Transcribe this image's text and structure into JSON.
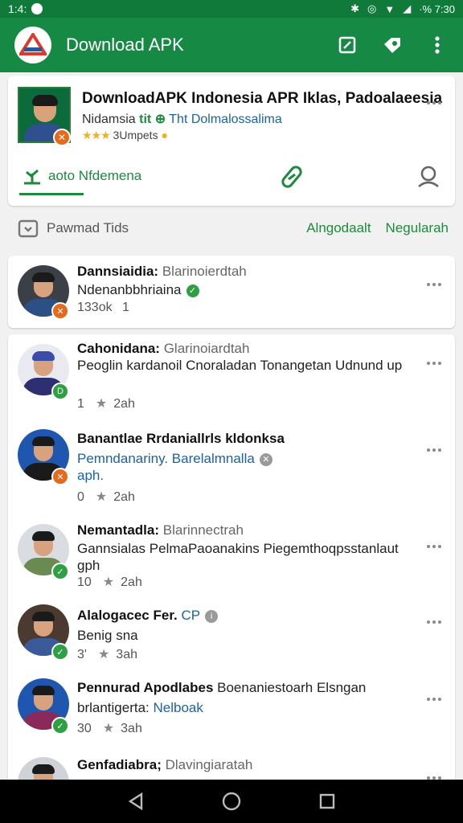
{
  "status": {
    "time": "1:4:",
    "right": "·% 7:30"
  },
  "appbar": {
    "title": "Download APK",
    "brand_color": "#168a45"
  },
  "app_card": {
    "name": "DownloadAPK Indonesia APR Iklas, Padoalaeesia",
    "developer_prefix": "Nidamsia",
    "developer_tag": "tit",
    "developer_link": "Tht Dolmalossalima",
    "stars": "★★★",
    "rating_text": "3Umpets",
    "tab1_label": "aoto Nfdemena"
  },
  "section": {
    "label": "Pawmad Tids",
    "right1": "Alngodaalt",
    "right2": "Negularah"
  },
  "items": [
    {
      "name": "Dannsiaidia:",
      "source": "Blarinoierdtah",
      "text": "Ndenanbbhriaina",
      "meta_a": "133ok",
      "meta_b": "1"
    },
    {
      "name": "Cahonidana:",
      "source": "Glarinoiardtah",
      "text": "Peoglin kardanoil Cnoraladan Tonangetan Udnund up",
      "meta_a": "1",
      "meta_b": "2ah"
    },
    {
      "name": "Banantlae Rrdaniallrls kldonksa",
      "source": "",
      "text": "Pemndanariny. Barelalmnalla",
      "text2": "aph.",
      "meta_a": "0",
      "meta_b": "2ah"
    },
    {
      "name": "Nemantadla:",
      "source": "Blarinnectrah",
      "text": "Gannsialas PelmaPaoanakins Piegemthoqpsstanlaut gph",
      "meta_a": "10",
      "meta_b": "2ah"
    },
    {
      "name": "Alalogacec Fer.",
      "source": "CP",
      "text": "Benig sna",
      "meta_a": "3'",
      "meta_b": "3ah"
    },
    {
      "name": "Pennurad Apodlabes",
      "source": "Boenaniestoarh Elsngan",
      "text": "brlantigerta:",
      "text_link": "Nelboak",
      "meta_a": "30",
      "meta_b": "3ah"
    },
    {
      "name": "Genfadiabra;",
      "source": "Dlavingiaratah"
    }
  ]
}
